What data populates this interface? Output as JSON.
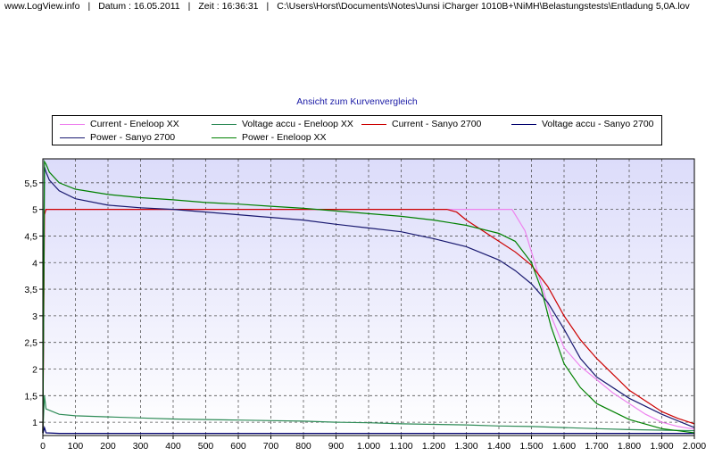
{
  "header": {
    "site": "www.LogView.info",
    "date": "Datum : 16.05.2011",
    "time": "Zeit : 16:36:31",
    "path": "C:\\Users\\Horst\\Documents\\Notes\\Junsi iCharger 1010B+\\NiMH\\Belastungstests\\Entladung 5,0A.lov"
  },
  "chart_data": {
    "type": "line",
    "title": "Ansicht zum Kurvenvergleich",
    "xlim": [
      0,
      2000
    ],
    "ylim": [
      0.75,
      5.95
    ],
    "grid": true,
    "legend_position": "top",
    "x_ticks": [
      0,
      100,
      200,
      300,
      400,
      500,
      600,
      700,
      800,
      900,
      1000,
      1100,
      1200,
      1300,
      1400,
      1500,
      1600,
      1700,
      1800,
      1900,
      2000
    ],
    "x_tick_labels": [
      "0",
      "100",
      "200",
      "300",
      "400",
      "500",
      "600",
      "700",
      "800",
      "900",
      "1.000",
      "1.100",
      "1.200",
      "1.300",
      "1.400",
      "1.500",
      "1.600",
      "1.700",
      "1.800",
      "1.900",
      "2.000"
    ],
    "y_ticks": [
      1,
      1.5,
      2,
      2.5,
      3,
      3.5,
      4,
      4.5,
      5,
      5.5
    ],
    "y_tick_labels": [
      "1",
      "1,5",
      "2",
      "2,5",
      "3",
      "3,5",
      "4",
      "4,5",
      "5",
      "5,5"
    ],
    "series": [
      {
        "name": "Current - Eneloop XX",
        "color": "#ee82ee",
        "x": [
          0,
          5,
          10,
          100,
          500,
          1000,
          1200,
          1440,
          1450,
          1480,
          1500,
          1530,
          1560,
          1600,
          1650,
          1700,
          1750,
          1800,
          1850,
          1900,
          1950,
          2000
        ],
        "y": [
          0.8,
          5.0,
          5.0,
          5.0,
          5.0,
          5.0,
          5.0,
          5.0,
          4.9,
          4.6,
          4.2,
          3.6,
          3.0,
          2.4,
          2.05,
          1.8,
          1.55,
          1.35,
          1.15,
          1.0,
          0.92,
          0.87
        ]
      },
      {
        "name": "Voltage accu - Eneloop XX",
        "color": "#2e8b57",
        "x": [
          0,
          5,
          10,
          50,
          100,
          200,
          300,
          400,
          500,
          600,
          700,
          800,
          900,
          1000,
          1100,
          1200,
          1300,
          1400,
          1500,
          1600,
          1700,
          1800,
          1900,
          2000
        ],
        "y": [
          0.8,
          1.5,
          1.25,
          1.15,
          1.12,
          1.1,
          1.08,
          1.06,
          1.05,
          1.04,
          1.03,
          1.02,
          1.0,
          0.99,
          0.97,
          0.96,
          0.95,
          0.93,
          0.92,
          0.9,
          0.88,
          0.86,
          0.85,
          0.84
        ]
      },
      {
        "name": "Current - Sanyo 2700",
        "color": "#cc0000",
        "x": [
          0,
          5,
          10,
          100,
          500,
          1000,
          1240,
          1270,
          1300,
          1350,
          1400,
          1450,
          1500,
          1550,
          1600,
          1650,
          1700,
          1750,
          1800,
          1850,
          1900,
          1950,
          2000
        ],
        "y": [
          0.8,
          4.9,
          5.0,
          5.0,
          5.0,
          5.0,
          5.0,
          4.95,
          4.8,
          4.6,
          4.4,
          4.2,
          3.95,
          3.55,
          3.0,
          2.55,
          2.2,
          1.9,
          1.6,
          1.4,
          1.2,
          1.07,
          0.97
        ]
      },
      {
        "name": "Voltage accu - Sanyo 2700",
        "color": "#00006e",
        "x": [
          0,
          5,
          10,
          50,
          100,
          300,
          500,
          700,
          900,
          1100,
          1300,
          1500,
          1700,
          1900,
          2000
        ],
        "y": [
          0.78,
          0.9,
          0.8,
          0.79,
          0.79,
          0.79,
          0.79,
          0.79,
          0.79,
          0.79,
          0.79,
          0.79,
          0.79,
          0.79,
          0.79
        ]
      },
      {
        "name": "Power - Sanyo 2700",
        "color": "#191970",
        "x": [
          0,
          5,
          10,
          20,
          50,
          100,
          200,
          300,
          400,
          500,
          600,
          700,
          800,
          900,
          1000,
          1100,
          1200,
          1300,
          1400,
          1450,
          1500,
          1550,
          1600,
          1650,
          1700,
          1800,
          1900,
          2000
        ],
        "y": [
          0.8,
          5.8,
          5.7,
          5.55,
          5.35,
          5.2,
          5.08,
          5.03,
          5.0,
          4.95,
          4.9,
          4.85,
          4.8,
          4.72,
          4.65,
          4.58,
          4.45,
          4.3,
          4.05,
          3.85,
          3.6,
          3.25,
          2.75,
          2.2,
          1.85,
          1.45,
          1.15,
          0.9
        ]
      },
      {
        "name": "Power - Eneloop XX",
        "color": "#008000",
        "x": [
          0,
          5,
          10,
          20,
          50,
          100,
          200,
          300,
          400,
          500,
          600,
          700,
          800,
          900,
          1000,
          1100,
          1200,
          1300,
          1400,
          1450,
          1500,
          1530,
          1560,
          1600,
          1650,
          1700,
          1800,
          1900,
          2000
        ],
        "y": [
          0.8,
          5.9,
          5.85,
          5.7,
          5.5,
          5.38,
          5.28,
          5.22,
          5.18,
          5.13,
          5.1,
          5.06,
          5.02,
          4.97,
          4.92,
          4.87,
          4.8,
          4.7,
          4.55,
          4.4,
          4.0,
          3.5,
          2.8,
          2.1,
          1.65,
          1.35,
          1.05,
          0.88,
          0.8
        ]
      }
    ]
  }
}
